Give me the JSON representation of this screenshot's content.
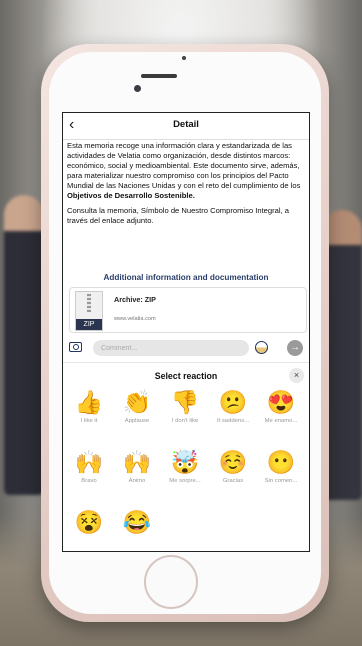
{
  "header": {
    "back_glyph": "‹",
    "title": "Detail"
  },
  "body": {
    "p1_text": "Esta memoria recoge una información clara y estandarizada de las actividades de Velatia como organización, desde distintos marcos: económico, social y medioambiental. Este documento sirve, además, para materializar nuestro compromiso con los principios del Pacto Mundial de las Naciones Unidas y con el reto del cumplimiento de los ",
    "p1_bold": "Objetivos de Desarrollo Sostenible.",
    "p2_text": "Consulta la memoria, Símbolo de Nuestro Compromiso Integral, a través del enlace adjunto."
  },
  "attachments": {
    "section_title": "Additional information and documentation",
    "file_type_label": "ZIP",
    "file_name": "Archive: ZIP",
    "file_url": "www.velatia.com"
  },
  "comment": {
    "placeholder": "Comment...",
    "camera_icon": "camera-icon",
    "emoji_icon": "emoji-icon",
    "send_icon": "send-arrow-icon"
  },
  "reactions": {
    "title": "Select reaction",
    "close_glyph": "×",
    "items": [
      {
        "emoji": "👍",
        "label": "I like it"
      },
      {
        "emoji": "👏",
        "label": "Applause"
      },
      {
        "emoji": "👎",
        "label": "I don't like"
      },
      {
        "emoji": "😕",
        "label": "It saddens..."
      },
      {
        "emoji": "😍",
        "label": "Me enamo..."
      },
      {
        "emoji": "🙌",
        "label": "Bravo"
      },
      {
        "emoji": "🙌",
        "label": "Ánimo"
      },
      {
        "emoji": "🤯",
        "label": "Me sorpre..."
      },
      {
        "emoji": "☺️",
        "label": "Gracias"
      },
      {
        "emoji": "😶",
        "label": "Sin comen..."
      },
      {
        "emoji": "😵",
        "label": ""
      },
      {
        "emoji": "😂",
        "label": ""
      }
    ]
  },
  "colors": {
    "accent": "#1f3566",
    "phone_body": "#e8d2cb"
  }
}
